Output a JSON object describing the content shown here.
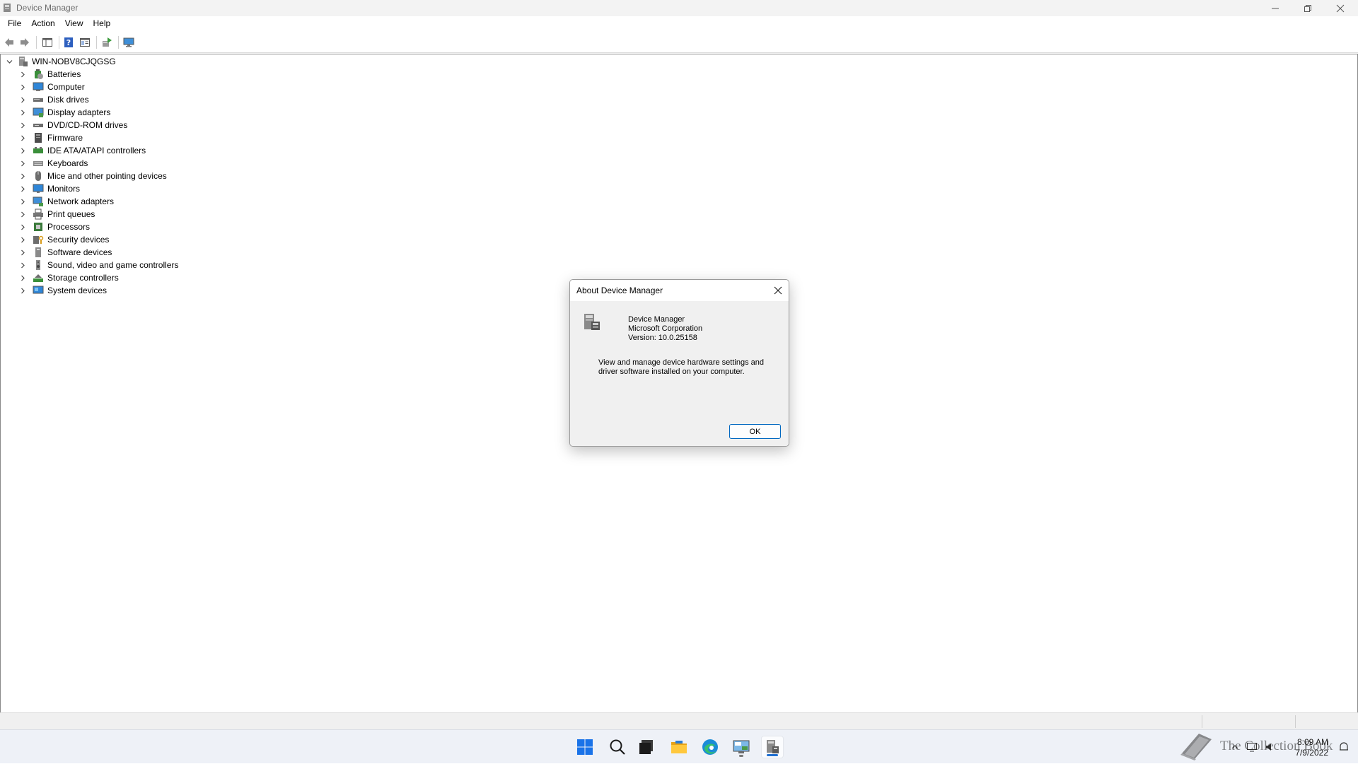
{
  "window": {
    "title": "Device Manager",
    "buttons": [
      "minimize-icon",
      "restore-icon",
      "close-icon"
    ]
  },
  "menu": [
    "File",
    "Action",
    "View",
    "Help"
  ],
  "toolbar": {
    "buttons": [
      "back-arrow-icon",
      "forward-arrow-icon",
      "show-hide-console-tree-icon",
      "help-icon",
      "properties-icon",
      "update-driver-icon",
      "scan-hardware-changes-icon"
    ]
  },
  "tree": {
    "root": "WIN-NOBV8CJQGSG",
    "items": [
      {
        "label": "Batteries",
        "icon": "battery-icon"
      },
      {
        "label": "Computer",
        "icon": "computer-icon"
      },
      {
        "label": "Disk drives",
        "icon": "disk-drive-icon"
      },
      {
        "label": "Display adapters",
        "icon": "display-adapter-icon"
      },
      {
        "label": "DVD/CD-ROM drives",
        "icon": "dvd-drive-icon"
      },
      {
        "label": "Firmware",
        "icon": "firmware-icon"
      },
      {
        "label": "IDE ATA/ATAPI controllers",
        "icon": "ide-controller-icon"
      },
      {
        "label": "Keyboards",
        "icon": "keyboard-icon"
      },
      {
        "label": "Mice and other pointing devices",
        "icon": "mouse-icon"
      },
      {
        "label": "Monitors",
        "icon": "monitor-icon"
      },
      {
        "label": "Network adapters",
        "icon": "network-adapter-icon"
      },
      {
        "label": "Print queues",
        "icon": "printer-icon"
      },
      {
        "label": "Processors",
        "icon": "processor-icon"
      },
      {
        "label": "Security devices",
        "icon": "security-device-icon"
      },
      {
        "label": "Software devices",
        "icon": "software-device-icon"
      },
      {
        "label": "Sound, video and game controllers",
        "icon": "speaker-icon"
      },
      {
        "label": "Storage controllers",
        "icon": "storage-controller-icon"
      },
      {
        "label": "System devices",
        "icon": "system-devices-icon"
      }
    ]
  },
  "dialog": {
    "title": "About Device Manager",
    "app_name": "Device Manager",
    "company": "Microsoft Corporation",
    "version": "Version: 10.0.25158",
    "description": "View and manage device hardware settings and driver software installed on your computer.",
    "ok_label": "OK"
  },
  "taskbar": {
    "apps": [
      "start-icon",
      "search-icon",
      "task-view-icon",
      "file-explorer-icon",
      "edge-icon",
      "control-panel-icon",
      "device-manager-icon"
    ],
    "time": "8:09 AM",
    "date": "7/9/2022",
    "watermark": "The Collection Book"
  }
}
